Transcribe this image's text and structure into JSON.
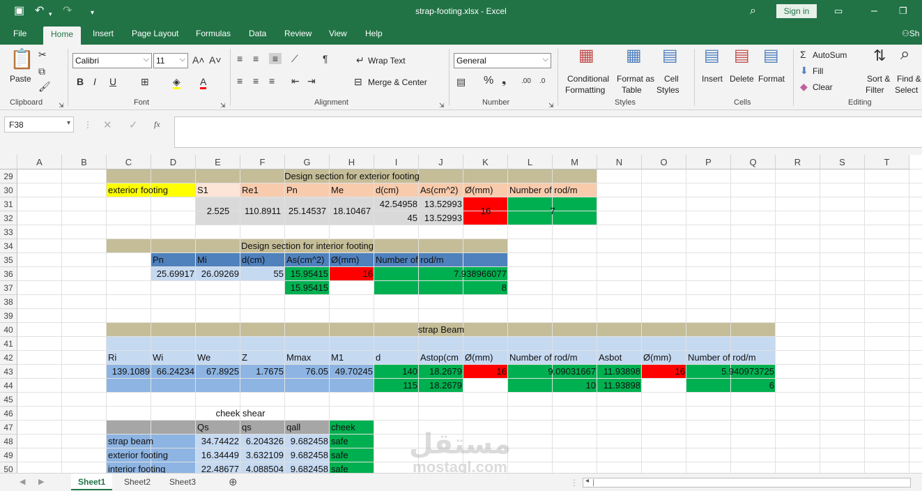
{
  "window": {
    "title": "strap-footing.xlsx  -  Excel",
    "sign_in": "Sign in"
  },
  "tabs": [
    "File",
    "Home",
    "Insert",
    "Page Layout",
    "Formulas",
    "Data",
    "Review",
    "View",
    "Help",
    "Sh"
  ],
  "ribbon": {
    "clipboard": {
      "paste": "Paste",
      "label": "Clipboard"
    },
    "font": {
      "name": "Calibri",
      "size": "11",
      "label": "Font"
    },
    "alignment": {
      "wrap": "Wrap Text",
      "merge": "Merge & Center",
      "label": "Alignment"
    },
    "number": {
      "format": "General",
      "label": "Number"
    },
    "styles": {
      "cond1": "Conditional",
      "cond2": "Formatting",
      "fmt1": "Format as",
      "fmt2": "Table",
      "cell1": "Cell",
      "cell2": "Styles",
      "label": "Styles"
    },
    "cells": {
      "insert": "Insert",
      "delete": "Delete",
      "format": "Format",
      "label": "Cells"
    },
    "editing": {
      "autosum": "AutoSum",
      "fill": "Fill",
      "clear": "Clear",
      "sort1": "Sort &",
      "sort2": "Filter",
      "find1": "Find &",
      "find2": "Select",
      "label": "Editing"
    }
  },
  "formula_bar": {
    "name_box": "F38",
    "fx": "fx",
    "formula": ""
  },
  "columns": [
    "A",
    "B",
    "C",
    "D",
    "E",
    "F",
    "G",
    "H",
    "I",
    "J",
    "K",
    "L",
    "M",
    "N",
    "O",
    "P",
    "Q",
    "R",
    "S",
    "T"
  ],
  "rows": [
    "29",
    "30",
    "31",
    "32",
    "33",
    "34",
    "35",
    "36",
    "37",
    "38",
    "39",
    "40",
    "41",
    "42",
    "43",
    "44",
    "45",
    "46",
    "47",
    "48",
    "49",
    "50"
  ],
  "cells": {
    "t1": "Design section for exterior footing",
    "ext_label": "exterior footing",
    "s1": "S1",
    "re1": "Re1",
    "pn": "Pn",
    "me": "Me",
    "dcm": "d(cm)",
    "as": "As(cm^2)",
    "phi": "Ø(mm)",
    "nrod": "Number of rod/m",
    "v_s1": "2.525",
    "v_re1": "110.8911",
    "v_pn": "25.14537",
    "v_me": "18.10467",
    "v_d1": "42.54958",
    "v_d2": "45",
    "v_as1": "13.52993",
    "v_as2": "13.52993",
    "v_phi": "16",
    "v_nrod": "7",
    "t2": "Design section for interior footing",
    "i_pn": "Pn",
    "i_mi": "Mi",
    "i_d": "d(cm)",
    "i_as": "As(cm^2)",
    "i_phi": "Ø(mm)",
    "i_nrod": "Number of rod/m",
    "iv_pn": "25.69917",
    "iv_mi": "26.09269",
    "iv_d": "55",
    "iv_as1": "15.95415",
    "iv_as2": "15.95415",
    "iv_phi": "16",
    "iv_n1": "7.938966077",
    "iv_n2": "8",
    "t3": "strap Beam",
    "b_ri": "Ri",
    "b_wi": "Wi",
    "b_we": "We",
    "b_z": "Z",
    "b_mmax": "Mmax",
    "b_m1": "M1",
    "b_d": "d",
    "b_astop": "Astop(cm",
    "b_phi": "Ø(mm)",
    "b_nrod": "Number of rod/m",
    "b_asbot": "Asbot",
    "b_phi2": "Ø(mm)",
    "b_nrod2": "Number of rod/m",
    "bv_ri": "139.1089",
    "bv_wi": "66.24234",
    "bv_we": "67.8925",
    "bv_z": "1.7675",
    "bv_mmax": "76.05",
    "bv_m1": "49.70245",
    "bv_d1": "140",
    "bv_d2": "115",
    "bv_ast1": "18.2679",
    "bv_ast2": "18.2679",
    "bv_phi": "16",
    "bv_n1": "9.09031667",
    "bv_n2": "10",
    "bv_asb1": "11.93898",
    "bv_asb2": "11.93898",
    "bv_phi2": "16",
    "bv_nb1": "5.940973725",
    "bv_nb2": "6",
    "t4": "cheek shear",
    "c_qs": "Qs",
    "c_qs2": "qs",
    "c_qall": "qall",
    "c_cheek": "cheek",
    "c_r1": "strap beam",
    "c_r1a": "34.74422",
    "c_r1b": "6.204326",
    "c_r1c": "9.682458",
    "c_r1d": "safe",
    "c_r2": " exterior footing",
    "c_r2a": "16.34449",
    "c_r2b": "3.632109",
    "c_r2c": "9.682458",
    "c_r2d": "safe",
    "c_r3": "interior footing",
    "c_r3a": "22.48677",
    "c_r3b": "4.088504",
    "c_r3c": "9.682458",
    "c_r3d": "safe"
  },
  "sheets": [
    "Sheet1",
    "Sheet2",
    "Sheet3"
  ],
  "watermark": {
    "ar": "مستقل",
    "en": "mostaql.com"
  },
  "colors": {
    "excel_green": "#217346",
    "tan": "#c4bd97",
    "yellow": "#ffff00",
    "peach": "#fce4d6",
    "orange_hdr": "#f8cbad",
    "grey": "#d9d9d9",
    "red": "#ff0000",
    "green": "#00b050",
    "blue": "#4f81bd",
    "light_blue": "#c5d9f1",
    "mid_blue": "#8db4e2",
    "dark_grey": "#a6a6a6"
  }
}
